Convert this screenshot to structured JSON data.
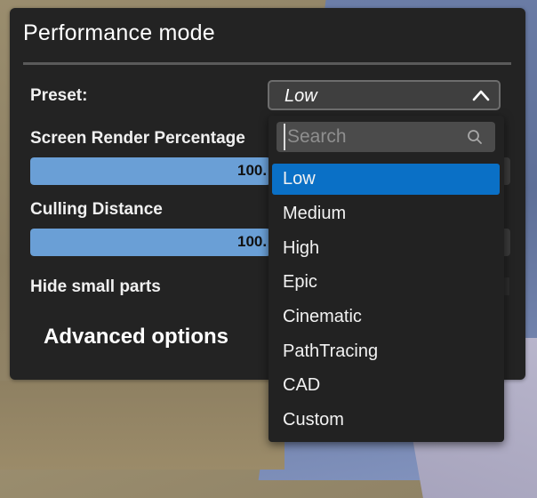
{
  "panel": {
    "title": "Performance mode",
    "preset": {
      "label": "Preset:",
      "value": "Low"
    },
    "screen_render_percentage": {
      "label": "Screen Render Percentage",
      "value_text": "100.",
      "fill_fraction": 0.5
    },
    "culling_distance": {
      "label": "Culling Distance",
      "value_text": "100.",
      "fill_fraction": 0.5
    },
    "hide_small_parts": {
      "label": "Hide small parts"
    },
    "advanced_options_label": "Advanced options"
  },
  "dropdown": {
    "search_placeholder": "Search",
    "options": [
      "Low",
      "Medium",
      "High",
      "Epic",
      "Cinematic",
      "PathTracing",
      "CAD",
      "Custom"
    ],
    "selected": "Low"
  },
  "colors": {
    "panel_bg": "#232323",
    "accent_selected": "#0a70c6",
    "slider_fill": "#6a9fd6"
  },
  "icons": {
    "combo_chevron": "chevron-up-icon",
    "search": "search-icon"
  }
}
